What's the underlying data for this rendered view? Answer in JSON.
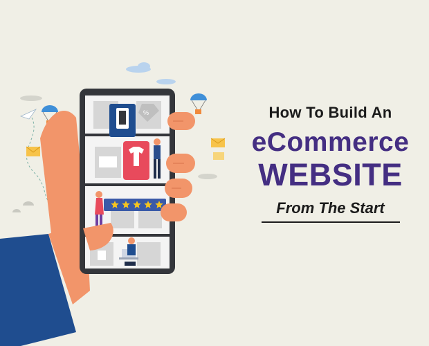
{
  "headline": {
    "line1": "How To Build An",
    "line2": "eCommerce",
    "line3": "WEBSITE",
    "line4": "From The Start"
  },
  "colors": {
    "background": "#f0efe6",
    "title_dark": "#1b1b1b",
    "title_purple": "#442e82",
    "sleeve_blue": "#1f4d8f",
    "skin": "#f2956a",
    "phone_frame": "#34363b",
    "rating_bar": "#3a5aa8",
    "star": "#f7c51e",
    "product_red": "#e84a5c"
  },
  "rating": {
    "stars": 5,
    "filled": 5
  },
  "icons": [
    "parachute-icon",
    "paper-plane-icon",
    "envelope-icon",
    "cloud-icon",
    "smartphone-icon",
    "tshirt-icon",
    "price-tag-icon",
    "star-icon",
    "laptop-icon",
    "bag-icon"
  ]
}
